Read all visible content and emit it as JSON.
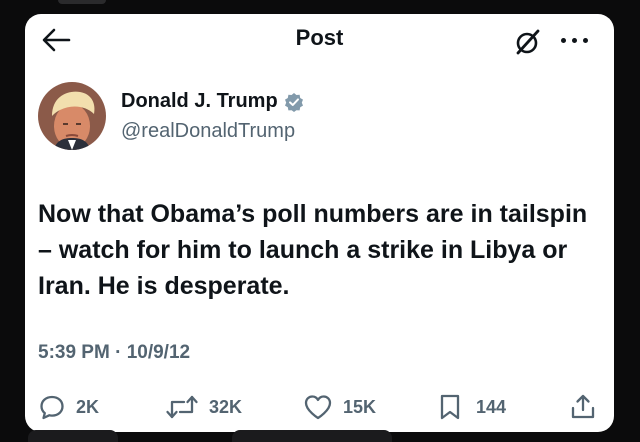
{
  "header": {
    "title": "Post"
  },
  "author": {
    "name": "Donald J. Trump",
    "handle": "@realDonaldTrump",
    "verified": true
  },
  "post": {
    "text": "Now that Obama’s poll numbers are in tailspin – watch for him to launch a strike in Libya or Iran.  He is desperate.",
    "timestamp": "5:39 PM · 10/9/12"
  },
  "actions": {
    "replies": "2K",
    "reposts": "32K",
    "likes": "15K",
    "bookmarks": "144"
  },
  "colors": {
    "text_primary": "#0f1419",
    "text_secondary": "#536471",
    "verified_badge": "#829aab",
    "background": "#0b0b0c",
    "card": "#ffffff"
  },
  "icons": [
    "back-arrow-icon",
    "grok-icon",
    "more-icon",
    "verified-badge-icon",
    "reply-icon",
    "repost-icon",
    "like-icon",
    "bookmark-icon",
    "share-icon"
  ]
}
